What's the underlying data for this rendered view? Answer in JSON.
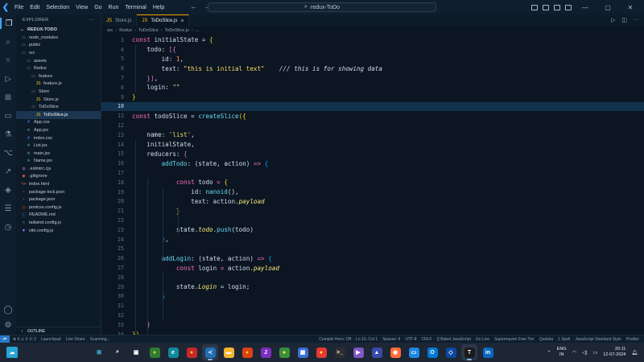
{
  "menu": [
    "File",
    "Edit",
    "Selection",
    "View",
    "Go",
    "Run",
    "Terminal",
    "Help"
  ],
  "search": {
    "text": "redux-ToDo"
  },
  "explorer": {
    "title": "EXPLORER",
    "root": "REDUX-TODO",
    "outline": "OUTLINE",
    "items": [
      {
        "label": "node_modules",
        "depth": 1,
        "icon": "folder-icon",
        "color": "#8fa1b3"
      },
      {
        "label": "public",
        "depth": 1,
        "icon": "folder-icon",
        "color": "#8fa1b3"
      },
      {
        "label": "src",
        "depth": 1,
        "icon": "folder-icon",
        "color": "#8fa1b3"
      },
      {
        "label": "assets",
        "depth": 2,
        "icon": "folder-icon",
        "color": "#8fa1b3"
      },
      {
        "label": "Redux",
        "depth": 2,
        "icon": "folder-icon",
        "color": "#8fa1b3"
      },
      {
        "label": "feature",
        "depth": 3,
        "icon": "folder-icon",
        "color": "#8fa1b3"
      },
      {
        "label": "feature.js",
        "depth": 4,
        "icon": "js-file-icon",
        "color": "#f1c40f"
      },
      {
        "label": "Store",
        "depth": 3,
        "icon": "folder-icon",
        "color": "#8fa1b3"
      },
      {
        "label": "Store.js",
        "depth": 4,
        "icon": "js-file-icon",
        "color": "#f1c40f"
      },
      {
        "label": "ToDoSlice",
        "depth": 3,
        "icon": "folder-icon",
        "color": "#8fa1b3"
      },
      {
        "label": "ToDoSlice.js",
        "depth": 4,
        "icon": "js-file-icon",
        "color": "#f1c40f",
        "selected": true
      },
      {
        "label": "App.css",
        "depth": 2,
        "icon": "css-file-icon",
        "color": "#3ea6ff"
      },
      {
        "label": "App.jsx",
        "depth": 2,
        "icon": "react-file-icon",
        "color": "#61dafb"
      },
      {
        "label": "index.css",
        "depth": 2,
        "icon": "css-file-icon",
        "color": "#3ea6ff"
      },
      {
        "label": "List.jsx",
        "depth": 2,
        "icon": "react-file-icon",
        "color": "#61dafb"
      },
      {
        "label": "main.jsx",
        "depth": 2,
        "icon": "react-file-icon",
        "color": "#61dafb"
      },
      {
        "label": "Name.jsx",
        "depth": 2,
        "icon": "react-file-icon",
        "color": "#61dafb"
      },
      {
        "label": ".eslintrc.cjs",
        "depth": 1,
        "icon": "eslint-file-icon",
        "color": "#8e7cc3"
      },
      {
        "label": ".gitignore",
        "depth": 1,
        "icon": "git-file-icon",
        "color": "#e4573d"
      },
      {
        "label": "index.html",
        "depth": 1,
        "icon": "html-file-icon",
        "color": "#e4743d"
      },
      {
        "label": "package-lock.json",
        "depth": 1,
        "icon": "npm-file-icon",
        "color": "#cb3837"
      },
      {
        "label": "package.json",
        "depth": 1,
        "icon": "npm-file-icon",
        "color": "#cb3837"
      },
      {
        "label": "postcss.config.js",
        "depth": 1,
        "icon": "postcss-file-icon",
        "color": "#dd3a0a"
      },
      {
        "label": "README.md",
        "depth": 1,
        "icon": "info-file-icon",
        "color": "#3ea6ff"
      },
      {
        "label": "tailwind.config.js",
        "depth": 1,
        "icon": "tailwind-file-icon",
        "color": "#38bdf8"
      },
      {
        "label": "vite.config.js",
        "depth": 1,
        "icon": "vite-file-icon",
        "color": "#a78bfa"
      }
    ]
  },
  "tabs": [
    {
      "label": "Store.js",
      "active": false
    },
    {
      "label": "ToDoSlice.js",
      "active": true
    }
  ],
  "breadcrumb": [
    "src",
    "Redux",
    "ToDoSlice",
    "ToDoSlice.js",
    "..."
  ],
  "code": [
    {
      "n": "3",
      "t": [
        [
          "kw",
          "const "
        ],
        [
          "var",
          "initialState "
        ],
        [
          "var",
          "= "
        ],
        [
          "br1",
          "{"
        ]
      ]
    },
    {
      "n": "4",
      "t": [
        [
          "var",
          "    todo"
        ],
        [
          "var",
          ": "
        ],
        [
          "br2",
          "[{"
        ]
      ]
    },
    {
      "n": "5",
      "t": [
        [
          "var",
          "        id"
        ],
        [
          "var",
          ": "
        ],
        [
          "num",
          "1"
        ],
        [
          "var",
          ","
        ]
      ]
    },
    {
      "n": "6",
      "t": [
        [
          "var",
          "        text"
        ],
        [
          "var",
          ": "
        ],
        [
          "str",
          "\"this is initial text\""
        ],
        [
          "com",
          "    /// this is for showing data"
        ]
      ]
    },
    {
      "n": "7",
      "t": [
        [
          "br2",
          "    }]"
        ],
        [
          "var",
          ","
        ]
      ]
    },
    {
      "n": "8",
      "t": [
        [
          "var",
          "    login"
        ],
        [
          "var",
          ": "
        ],
        [
          "str",
          "\"\""
        ]
      ]
    },
    {
      "n": "9",
      "t": [
        [
          "br1",
          "}"
        ]
      ]
    },
    {
      "n": "10",
      "t": [],
      "current": true
    },
    {
      "n": "11",
      "t": [
        [
          "kw",
          "const "
        ],
        [
          "var",
          "todoSlice "
        ],
        [
          "var",
          "= "
        ],
        [
          "fn",
          "createSlice"
        ],
        [
          "br1",
          "({"
        ]
      ]
    },
    {
      "n": "12",
      "t": []
    },
    {
      "n": "13",
      "t": [
        [
          "var",
          "    name"
        ],
        [
          "var",
          ": "
        ],
        [
          "str",
          "'list'"
        ],
        [
          "var",
          ","
        ]
      ]
    },
    {
      "n": "14",
      "t": [
        [
          "var",
          "    initialState,"
        ]
      ]
    },
    {
      "n": "15",
      "t": [
        [
          "var",
          "    reducers"
        ],
        [
          "var",
          ": "
        ],
        [
          "br2",
          "{"
        ]
      ]
    },
    {
      "n": "16",
      "t": [
        [
          "fn",
          "        addTodo"
        ],
        [
          "var",
          ": ("
        ],
        [
          "var",
          "state"
        ],
        [
          "var",
          ", "
        ],
        [
          "var",
          "action"
        ],
        [
          "var",
          ") "
        ],
        [
          "kw",
          "=> "
        ],
        [
          "br3",
          "{"
        ]
      ]
    },
    {
      "n": "17",
      "t": []
    },
    {
      "n": "18",
      "t": [
        [
          "kw",
          "            const "
        ],
        [
          "var",
          "todo "
        ],
        [
          "kw",
          "= "
        ],
        [
          "br1",
          "{"
        ]
      ]
    },
    {
      "n": "19",
      "t": [
        [
          "var",
          "                id"
        ],
        [
          "var",
          ": "
        ],
        [
          "fn",
          "nanoid"
        ],
        [
          "var",
          "(),"
        ]
      ]
    },
    {
      "n": "20",
      "t": [
        [
          "var",
          "                text"
        ],
        [
          "var",
          ": "
        ],
        [
          "var",
          "action."
        ],
        [
          "it",
          "payload"
        ]
      ]
    },
    {
      "n": "21",
      "t": [
        [
          "br1",
          "            }"
        ]
      ]
    },
    {
      "n": "22",
      "t": []
    },
    {
      "n": "23",
      "t": [
        [
          "var",
          "            state."
        ],
        [
          "it",
          "todo"
        ],
        [
          "var",
          "."
        ],
        [
          "fn",
          "push"
        ],
        [
          "var",
          "(todo)"
        ]
      ]
    },
    {
      "n": "24",
      "t": [
        [
          "br3",
          "        }"
        ],
        [
          "var",
          ","
        ]
      ]
    },
    {
      "n": "25",
      "t": []
    },
    {
      "n": "26",
      "t": [
        [
          "fn",
          "        addLogin"
        ],
        [
          "var",
          ": ("
        ],
        [
          "var",
          "state"
        ],
        [
          "var",
          ", "
        ],
        [
          "var",
          "action"
        ],
        [
          "var",
          ") "
        ],
        [
          "kw",
          "=> "
        ],
        [
          "br3",
          "{"
        ]
      ]
    },
    {
      "n": "27",
      "t": [
        [
          "kw",
          "            const "
        ],
        [
          "var",
          "login "
        ],
        [
          "kw",
          "= "
        ],
        [
          "var",
          "action."
        ],
        [
          "it",
          "payload"
        ]
      ]
    },
    {
      "n": "28",
      "t": []
    },
    {
      "n": "29",
      "t": [
        [
          "var",
          "            state."
        ],
        [
          "it",
          "Login"
        ],
        [
          "var",
          " = login;"
        ]
      ]
    },
    {
      "n": "30",
      "t": [
        [
          "br3",
          "        }"
        ]
      ]
    },
    {
      "n": "31",
      "t": []
    },
    {
      "n": "32",
      "t": []
    },
    {
      "n": "33",
      "t": [
        [
          "br2",
          "    }"
        ]
      ]
    },
    {
      "n": "34",
      "t": [
        [
          "br1",
          "})"
        ]
      ]
    }
  ],
  "status": {
    "left": [
      "⊗ 0  ⚠ 0  ⓦ 2",
      "Launchpad",
      "Live Share",
      "Scanning..."
    ],
    "right": [
      "Compile Hero: Off",
      "Ln 10, Col 1",
      "Spaces: 4",
      "UTF-8",
      "CRLF",
      "{} Babel JavaScript",
      "Go Live",
      "Supermaven Free Tier",
      "Quokka",
      "1 Spell",
      "JavaScript Standard Style",
      "Prettier"
    ]
  },
  "taskbar": {
    "apps": [
      {
        "name": "start-icon",
        "glyph": "⊞",
        "bg": "transparent",
        "fg": "#4cc2ff"
      },
      {
        "name": "search-icon",
        "glyph": "⌕",
        "bg": "transparent",
        "fg": "#ffffff"
      },
      {
        "name": "task-view-icon",
        "glyph": "▣",
        "bg": "transparent",
        "fg": "#ffffff"
      },
      {
        "name": "chrome-icon",
        "glyph": "●",
        "bg": "#2e7d32",
        "fg": "#fbc02d"
      },
      {
        "name": "edge-icon",
        "glyph": "e",
        "bg": "#0f8a9c",
        "fg": "#ffffff"
      },
      {
        "name": "chrome-icon",
        "glyph": "●",
        "bg": "#c62828",
        "fg": "#fbc02d"
      },
      {
        "name": "vscode-icon",
        "glyph": "≺",
        "bg": "#1f6fb5",
        "fg": "#ffffff",
        "active": true
      },
      {
        "name": "file-explorer-icon",
        "glyph": "▬",
        "bg": "#f2b632",
        "fg": "#ffffff"
      },
      {
        "name": "chrome-icon",
        "glyph": "●",
        "bg": "#d84315",
        "fg": "#fbc02d"
      },
      {
        "name": "jetbrains-icon",
        "glyph": "J",
        "bg": "#7b2fbf",
        "fg": "#ffffff"
      },
      {
        "name": "chrome-icon",
        "glyph": "●",
        "bg": "#388e3c",
        "fg": "#ffeb3b"
      },
      {
        "name": "store-icon",
        "glyph": "▦",
        "bg": "#3a6fd8",
        "fg": "#ffffff"
      },
      {
        "name": "chrome-icon",
        "glyph": "●",
        "bg": "#e53935",
        "fg": "#ffeb3b"
      },
      {
        "name": "terminal-icon",
        "glyph": ">_",
        "bg": "#2d2d2d",
        "fg": "#ffffff"
      },
      {
        "name": "media-icon",
        "glyph": "▶",
        "bg": "#7e57c2",
        "fg": "#ffffff"
      },
      {
        "name": "photos-icon",
        "glyph": "▲",
        "bg": "#3949ab",
        "fg": "#ffffff"
      },
      {
        "name": "postman-icon",
        "glyph": "◉",
        "bg": "#ff6c37",
        "fg": "#ffffff"
      },
      {
        "name": "folder-icon",
        "glyph": "▭",
        "bg": "#1e88e5",
        "fg": "#ffffff"
      },
      {
        "name": "outlook-icon",
        "glyph": "O",
        "bg": "#0078d4",
        "fg": "#ffffff"
      },
      {
        "name": "ide-icon",
        "glyph": "◇",
        "bg": "#0d47a1",
        "fg": "#ffffff"
      },
      {
        "name": "typora-icon",
        "glyph": "T",
        "bg": "#1a1a1a",
        "fg": "#ffffff",
        "active": true
      },
      {
        "name": "linkedin-icon",
        "glyph": "in",
        "bg": "#0a66c2",
        "fg": "#ffffff"
      }
    ],
    "lang_top": "ENG",
    "lang_bottom": "IN",
    "time": "20:11",
    "date": "12-07-2024"
  }
}
